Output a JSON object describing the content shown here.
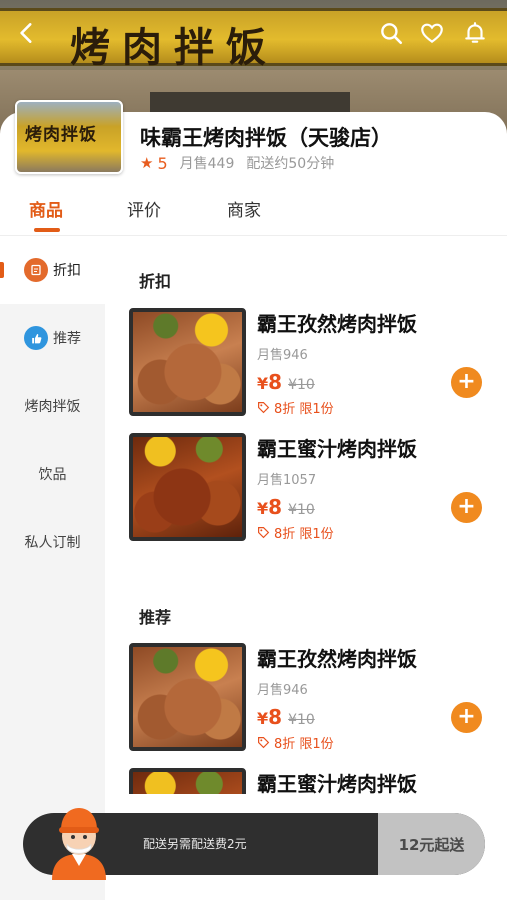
{
  "colors": {
    "accent": "#e25c17",
    "price": "#e8501c",
    "add_button": "#f08a1f",
    "cart_bar": "#2f2f2f"
  },
  "hero": {
    "sign_text": "烤肉拌饭",
    "icons": [
      "back-icon",
      "search-icon",
      "heart-icon",
      "bell-icon"
    ]
  },
  "store": {
    "logo_text": "烤肉拌饭",
    "name": "味霸王烤肉拌饭（天骏店）",
    "rating": "5",
    "monthly_sales": "月售449",
    "delivery_time": "配送约50分钟"
  },
  "tabs": [
    {
      "label": "商品",
      "active": true
    },
    {
      "label": "评价",
      "active": false
    },
    {
      "label": "商家",
      "active": false
    }
  ],
  "sidebar": {
    "items": [
      {
        "label": "折扣",
        "icon": "discount-icon",
        "active": true
      },
      {
        "label": "推荐",
        "icon": "thumbs-up-icon",
        "active": false
      },
      {
        "label": "烤肉拌饭",
        "active": false
      },
      {
        "label": "饮品",
        "active": false
      },
      {
        "label": "私人订制",
        "active": false
      }
    ]
  },
  "sections": [
    {
      "title": "折扣",
      "products": [
        {
          "name": "霸王孜然烤肉拌饭",
          "sales": "月售946",
          "currency": "¥",
          "price": "8",
          "original_price": "¥10",
          "promo": "8折 限1份"
        },
        {
          "name": "霸王蜜汁烤肉拌饭",
          "sales": "月售1057",
          "currency": "¥",
          "price": "8",
          "original_price": "¥10",
          "promo": "8折 限1份"
        }
      ]
    },
    {
      "title": "推荐",
      "products": [
        {
          "name": "霸王孜然烤肉拌饭",
          "sales": "月售946",
          "currency": "¥",
          "price": "8",
          "original_price": "¥10",
          "promo": "8折 限1份"
        },
        {
          "name": "霸王蜜汁烤肉拌饭"
        }
      ]
    }
  ],
  "cart": {
    "delivery_note": "配送另需配送费2元",
    "min_order": "12元起送"
  }
}
